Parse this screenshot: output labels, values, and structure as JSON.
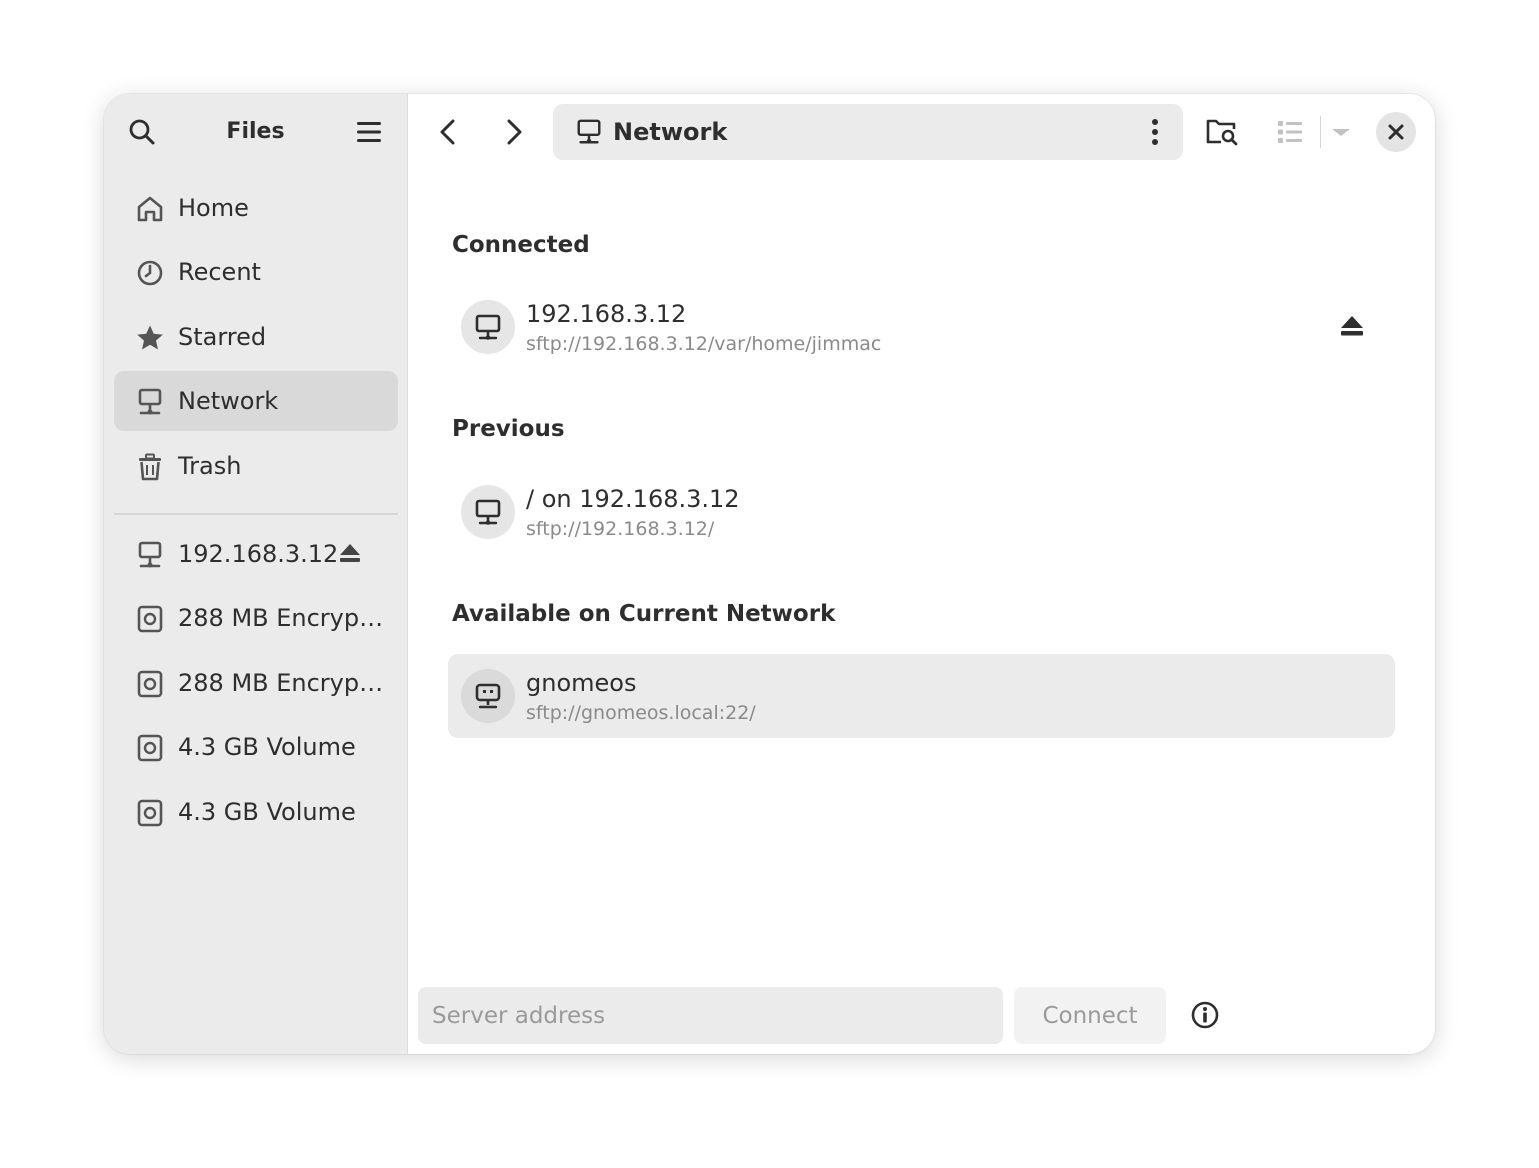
{
  "sidebar": {
    "title": "Files",
    "places": [
      {
        "label": "Home",
        "icon": "home-icon"
      },
      {
        "label": "Recent",
        "icon": "clock-icon"
      },
      {
        "label": "Starred",
        "icon": "star-icon"
      },
      {
        "label": "Network",
        "icon": "network-icon",
        "active": true
      },
      {
        "label": "Trash",
        "icon": "trash-icon"
      }
    ],
    "devices": [
      {
        "label": "192.168.3.12",
        "icon": "network-server-icon",
        "eject": true
      },
      {
        "label": "288 MB Encryp…",
        "icon": "drive-icon"
      },
      {
        "label": "288 MB Encryp…",
        "icon": "drive-icon"
      },
      {
        "label": "4.3 GB Volume",
        "icon": "drive-icon"
      },
      {
        "label": "4.3 GB Volume",
        "icon": "drive-icon"
      }
    ]
  },
  "header": {
    "location": "Network"
  },
  "sections": {
    "connected": "Connected",
    "previous": "Previous",
    "available": "Available on Current Network"
  },
  "connected": [
    {
      "title": "192.168.3.12",
      "uri": "sftp://192.168.3.12/var/home/jimmac"
    }
  ],
  "previous": [
    {
      "title": "/ on 192.168.3.12",
      "uri": "sftp://192.168.3.12/"
    }
  ],
  "available": [
    {
      "title": "gnomeos",
      "uri": "sftp://gnomeos.local:22/"
    }
  ],
  "footer": {
    "address_placeholder": "Server address",
    "connect_label": "Connect"
  }
}
